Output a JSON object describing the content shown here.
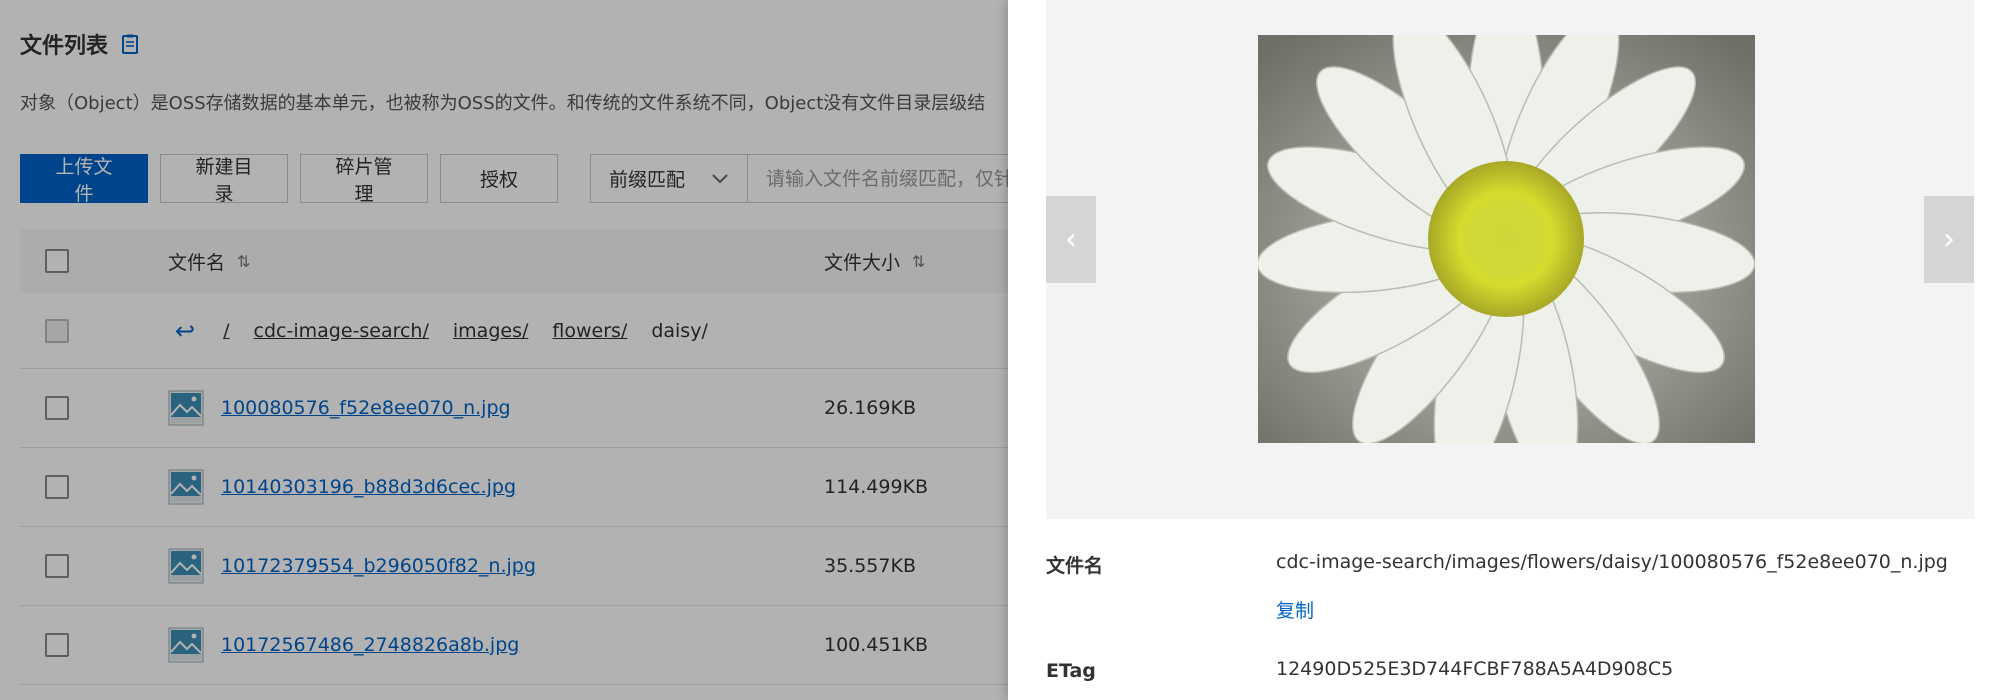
{
  "page": {
    "title": "文件列表",
    "description": "对象（Object）是OSS存储数据的基本单元，也被称为OSS的文件。和传统的文件系统不同，Object没有文件目录层级结"
  },
  "toolbar": {
    "upload_label": "上传文件",
    "new_dir_label": "新建目录",
    "fragments_label": "碎片管理",
    "authorize_label": "授权",
    "match_select": "前缀匹配",
    "search_placeholder": "请输入文件名前缀匹配，仅针"
  },
  "table": {
    "col_name": "文件名",
    "col_size": "文件大小",
    "breadcrumb": [
      "/",
      "cdc-image-search/",
      "images/",
      "flowers/"
    ],
    "breadcrumb_current": "daisy/",
    "rows": [
      {
        "name": "100080576_f52e8ee070_n.jpg",
        "size": "26.169KB"
      },
      {
        "name": "10140303196_b88d3d6cec.jpg",
        "size": "114.499KB"
      },
      {
        "name": "10172379554_b296050f82_n.jpg",
        "size": "35.557KB"
      },
      {
        "name": "10172567486_2748826a8b.jpg",
        "size": "100.451KB"
      }
    ]
  },
  "drawer": {
    "prev_glyph": "‹",
    "next_glyph": "›",
    "filename_label": "文件名",
    "filename_value": "cdc-image-search/images/flowers/daisy/100080576_f52e8ee070_n.jpg",
    "copy_label": "复制",
    "etag_label": "ETag",
    "etag_value": "12490D525E3D744FCBF788A5A4D908C5"
  },
  "colors": {
    "primary": "#0064c8",
    "overlay": "rgba(0,0,0,0.30)"
  }
}
